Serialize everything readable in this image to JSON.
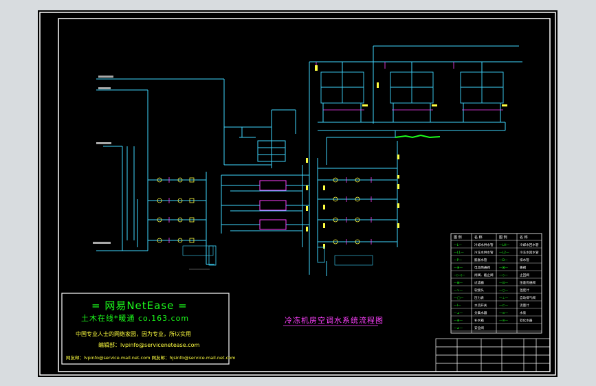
{
  "watermark": {
    "title": "= 网易NetEase =",
    "subtitle": "土木在线*暖通   co.163.com",
    "line1": "中国专业人士的网络家园，因为专业，所以实用",
    "line2": "编辑部：lvpinfo@servicenetease.com",
    "line3": "网友邮：lvpinfo@service.mail.net.com   网友邮：hjsinfo@service.mail.net.com"
  },
  "drawing": {
    "title": "冷冻机房空调水系统流程图"
  },
  "legend": {
    "headers": [
      "图 例",
      "名 称",
      "图 例",
      "名 称"
    ],
    "rows": [
      [
        "—L—",
        "冷却水供水管",
        "—LH—",
        "冷却水回水管"
      ],
      [
        "—L1—",
        "冷冻水供水管",
        "—L2—",
        "冷冻水回水管"
      ],
      [
        "—P—",
        "膨胀水管",
        "—D—",
        "排水管"
      ],
      [
        "—⊗—",
        "电动两通阀",
        "—⊠—",
        "蝶阀"
      ],
      [
        "—▷◁—",
        "闸阀、截止阀",
        "—◇—",
        "止回阀"
      ],
      [
        "—⊞—",
        "过滤器",
        "—⊡—",
        "压差旁通阀"
      ],
      [
        "—∿—",
        "软接头",
        "—○—",
        "温度计"
      ],
      [
        "—◯—",
        "压力表",
        "—⊥—",
        "自动排气阀"
      ],
      [
        "—I—",
        "水流开关",
        "—⊏—",
        "流量计"
      ],
      [
        "—⊿—",
        "分集水器",
        "—⊙—",
        "水泵"
      ],
      [
        "—⊕—",
        "补水箱",
        "—⊜—",
        "软化水器"
      ],
      [
        "—≠—",
        "安全阀",
        "",
        ""
      ]
    ]
  },
  "colors": {
    "background": "#000000",
    "frame": "#ffffff",
    "pipe_cyan": "#3fd7ff",
    "pipe_yellow": "#ffff40",
    "equipment_magenta": "#ff40ff",
    "highlight_green": "#1cff1c"
  }
}
